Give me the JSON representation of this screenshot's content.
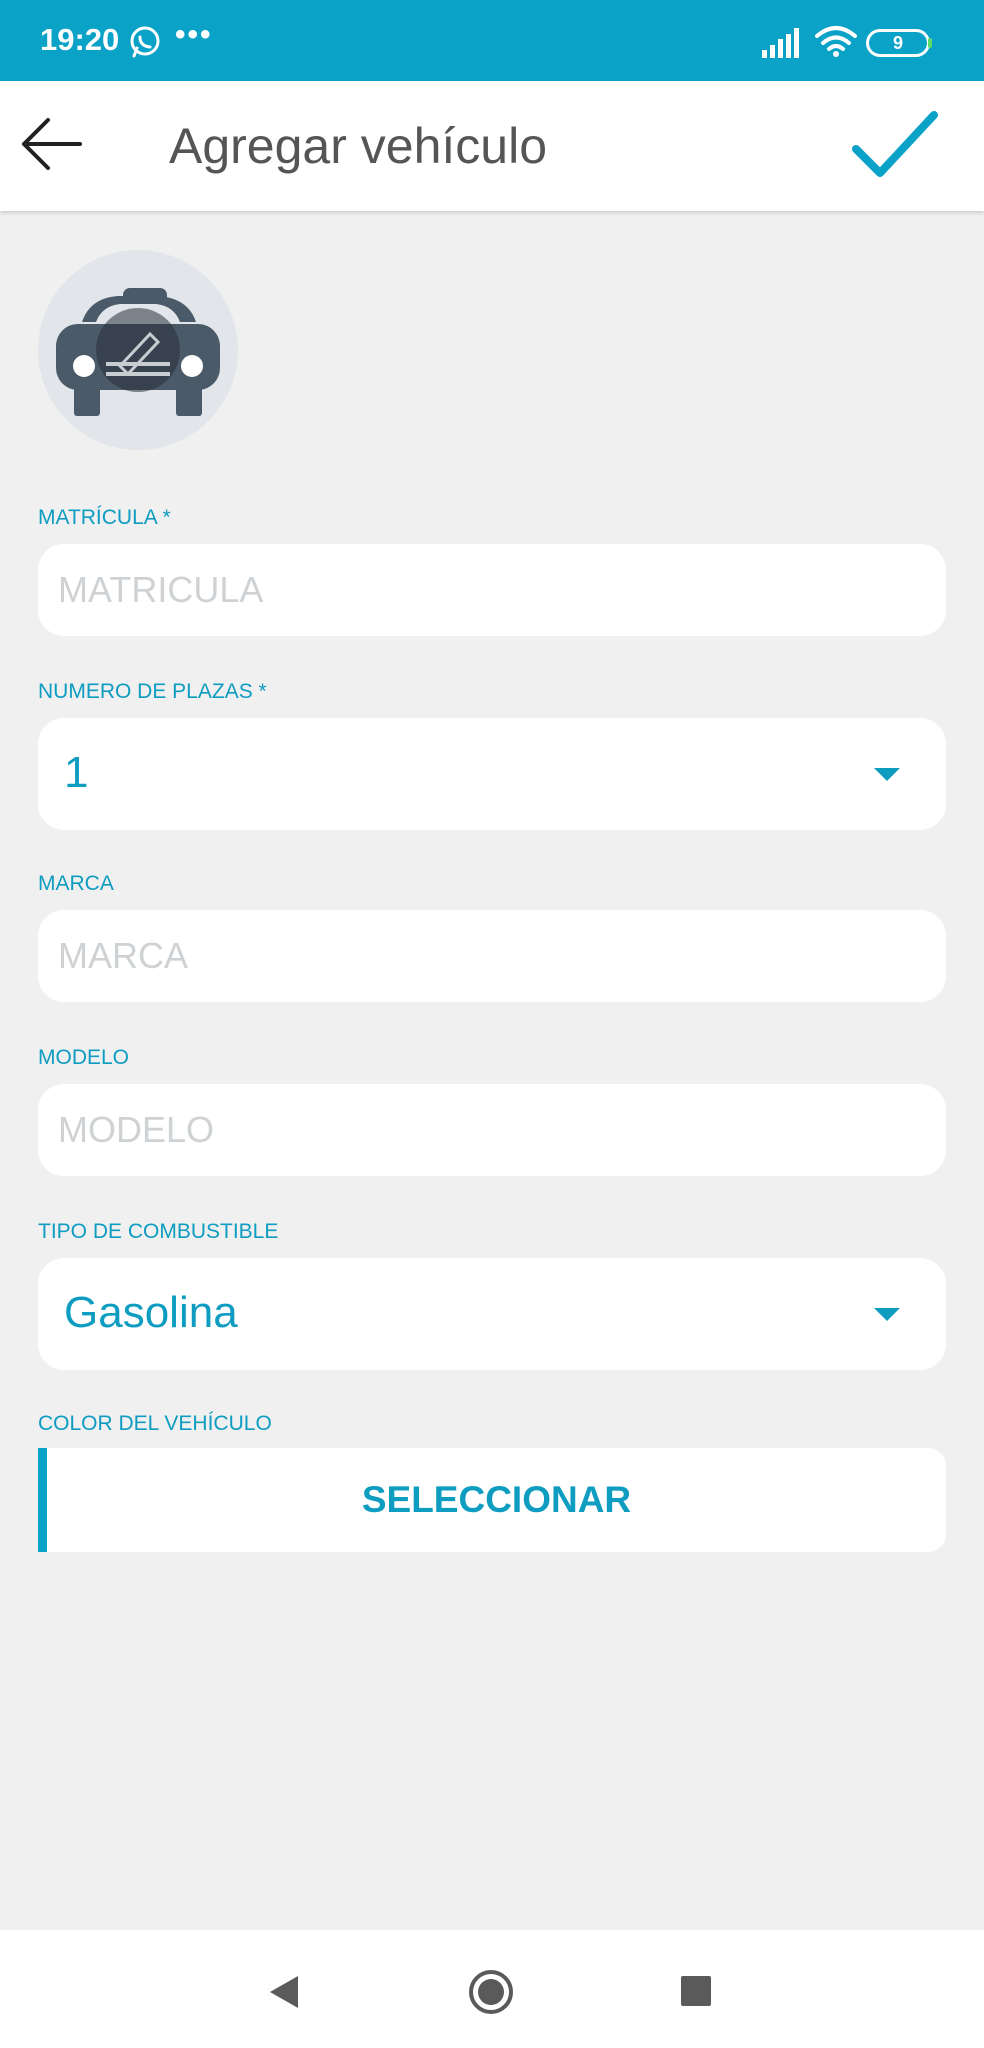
{
  "status_bar": {
    "time": "19:20",
    "dots": "•••",
    "battery": "9",
    "icons": [
      "whatsapp-icon",
      "signal-icon",
      "wifi-icon",
      "battery-icon"
    ]
  },
  "app_bar": {
    "title": "Agregar vehículo",
    "back_icon": "arrow-left-icon",
    "confirm_icon": "checkmark-icon"
  },
  "avatar": {
    "icon": "car-edit-icon"
  },
  "form": {
    "matricula": {
      "label": "MATRÍCULA *",
      "placeholder": "MATRICULA",
      "value": ""
    },
    "plazas": {
      "label": "NUMERO DE PLAZAS *",
      "value": "1"
    },
    "marca": {
      "label": "MARCA",
      "placeholder": "MARCA",
      "value": ""
    },
    "modelo": {
      "label": "MODELO",
      "placeholder": "MODELO",
      "value": ""
    },
    "combustible": {
      "label": "TIPO DE COMBUSTIBLE",
      "value": "Gasolina"
    },
    "color": {
      "label": "COLOR DEL VEHÍCULO",
      "button": "SELECCIONAR"
    }
  },
  "nav_bar": {
    "icons": [
      "nav-back-icon",
      "nav-home-icon",
      "nav-recents-icon"
    ]
  },
  "colors": {
    "primary": "#0aa2c7",
    "accent_text": "#0e9cc1",
    "background": "#f0f0f0"
  }
}
